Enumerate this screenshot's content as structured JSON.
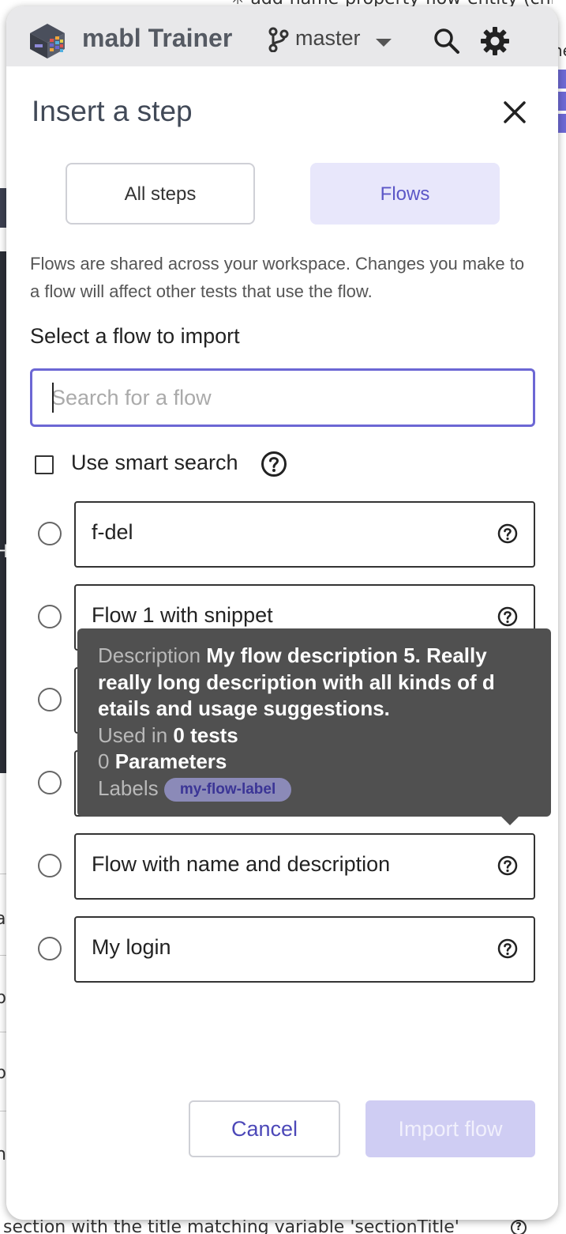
{
  "background": {
    "top_text": "✳ add-name-property-flow-entity (chrom",
    "right_text": "ne",
    "left_glyphs": [
      "ʲ",
      "I",
      "H",
      "a",
      "p",
      "b",
      "n"
    ],
    "bottom_text": "section with the title matching variable 'sectionTitle'",
    "bottom_help_icon": "?"
  },
  "trainer": {
    "app_title": "mabl Trainer",
    "branch": "master",
    "icons": {
      "logo": "mabl-logo-icon",
      "branch": "git-branch-icon",
      "caret": "caret-down-icon",
      "search": "search-icon",
      "settings": "gear-icon"
    }
  },
  "modal": {
    "title": "Insert a step",
    "close_icon": "close-icon",
    "tabs": [
      {
        "label": "All steps",
        "active": false
      },
      {
        "label": "Flows",
        "active": true
      }
    ],
    "info_text": "Flows are shared across your workspace. Changes you make to a flow will affect other tests that use the flow.",
    "select_label": "Select a flow to import",
    "search": {
      "placeholder": "Search for a flow",
      "value": ""
    },
    "smart_search": {
      "label": "Use smart search",
      "checked": false
    },
    "flows": [
      {
        "name": "f-del",
        "selected": false
      },
      {
        "name": "Flow 1 with snippet",
        "selected": false
      },
      {
        "name": "",
        "selected": false
      },
      {
        "name": "",
        "selected": false
      },
      {
        "name": "Flow with name and description",
        "selected": false
      },
      {
        "name": "My login",
        "selected": false
      }
    ],
    "tooltip": {
      "description_key": "Description",
      "description_line1": "My flow description 5. Really",
      "description_line2": "really long description with all kinds of d",
      "description_line3": "etails and usage suggestions.",
      "used_in_key": "Used in",
      "used_in_value": "0 tests",
      "params_count": "0",
      "params_label": "Parameters",
      "labels_key": "Labels",
      "label_chip": "my-flow-label"
    },
    "buttons": {
      "cancel": "Cancel",
      "import": "Import flow",
      "import_enabled": false
    }
  },
  "colors": {
    "accent": "#6c67d4",
    "accent_text": "#5b56c7",
    "active_tab_bg": "#e8e7fb",
    "tooltip_bg": "#505050",
    "disabled_button": "#cfcdf3"
  }
}
